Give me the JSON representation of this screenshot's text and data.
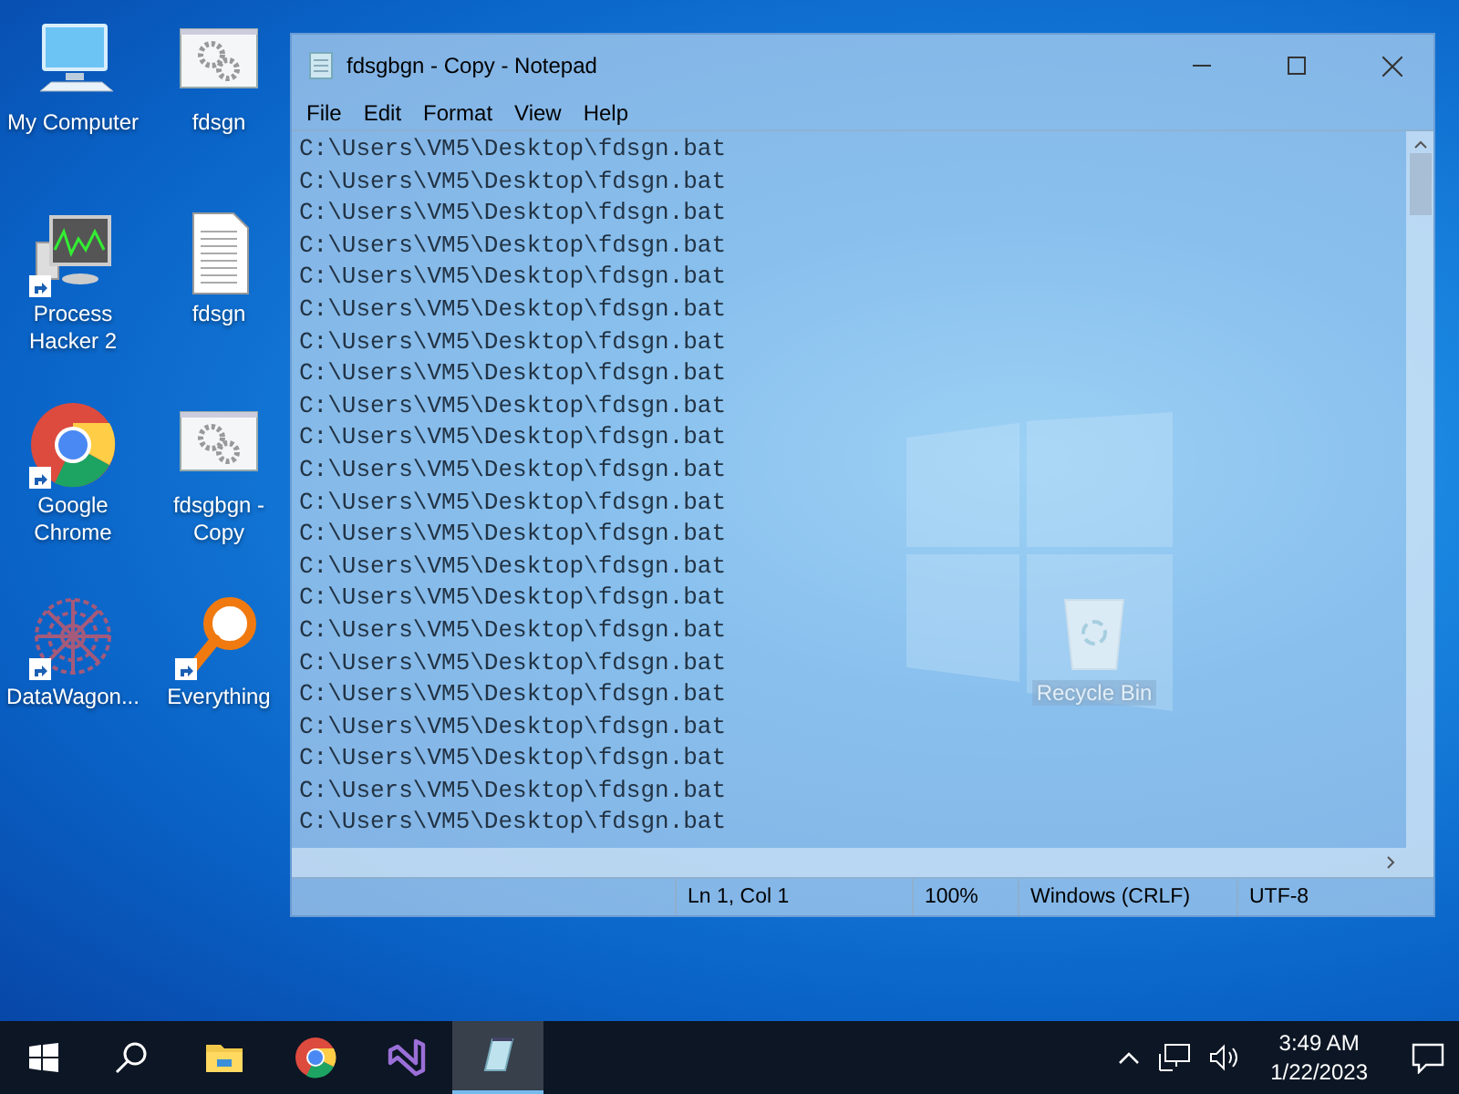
{
  "desktop_icons": [
    {
      "label": "My Computer",
      "kind": "computer",
      "shortcut": false
    },
    {
      "label": "fdsgn",
      "kind": "batch",
      "shortcut": false
    },
    {
      "label": "Process Hacker 2",
      "kind": "monitor",
      "shortcut": true
    },
    {
      "label": "fdsgn",
      "kind": "text",
      "shortcut": false
    },
    {
      "label": "Google Chrome",
      "kind": "chrome",
      "shortcut": true
    },
    {
      "label": "fdsgbgn - Copy",
      "kind": "batch",
      "shortcut": false
    },
    {
      "label": "DataWagon...",
      "kind": "mandala",
      "shortcut": true
    },
    {
      "label": "Everything",
      "kind": "magnifier",
      "shortcut": true
    }
  ],
  "recycle_bin": {
    "label": "Recycle Bin"
  },
  "notepad": {
    "title": "fdsgbgn - Copy - Notepad",
    "menu": [
      "File",
      "Edit",
      "Format",
      "View",
      "Help"
    ],
    "lines": [
      "C:\\Users\\VM5\\Desktop\\fdsgn.bat",
      "C:\\Users\\VM5\\Desktop\\fdsgn.bat",
      "C:\\Users\\VM5\\Desktop\\fdsgn.bat",
      "C:\\Users\\VM5\\Desktop\\fdsgn.bat",
      "C:\\Users\\VM5\\Desktop\\fdsgn.bat",
      "C:\\Users\\VM5\\Desktop\\fdsgn.bat",
      "C:\\Users\\VM5\\Desktop\\fdsgn.bat",
      "C:\\Users\\VM5\\Desktop\\fdsgn.bat",
      "C:\\Users\\VM5\\Desktop\\fdsgn.bat",
      "C:\\Users\\VM5\\Desktop\\fdsgn.bat",
      "C:\\Users\\VM5\\Desktop\\fdsgn.bat",
      "C:\\Users\\VM5\\Desktop\\fdsgn.bat",
      "C:\\Users\\VM5\\Desktop\\fdsgn.bat",
      "C:\\Users\\VM5\\Desktop\\fdsgn.bat",
      "C:\\Users\\VM5\\Desktop\\fdsgn.bat",
      "C:\\Users\\VM5\\Desktop\\fdsgn.bat",
      "C:\\Users\\VM5\\Desktop\\fdsgn.bat",
      "C:\\Users\\VM5\\Desktop\\fdsgn.bat",
      "C:\\Users\\VM5\\Desktop\\fdsgn.bat",
      "C:\\Users\\VM5\\Desktop\\fdsgn.bat",
      "C:\\Users\\VM5\\Desktop\\fdsgn.bat",
      "C:\\Users\\VM5\\Desktop\\fdsgn.bat"
    ],
    "status": {
      "position": "Ln 1, Col 1",
      "zoom": "100%",
      "line_endings": "Windows (CRLF)",
      "encoding": "UTF-8"
    }
  },
  "taskbar": {
    "apps": [
      {
        "kind": "folder",
        "active": false
      },
      {
        "kind": "chrome",
        "active": false
      },
      {
        "kind": "visual-studio",
        "active": false
      },
      {
        "kind": "notepad",
        "active": true
      }
    ],
    "time": "3:49 AM",
    "date": "1/22/2023"
  }
}
